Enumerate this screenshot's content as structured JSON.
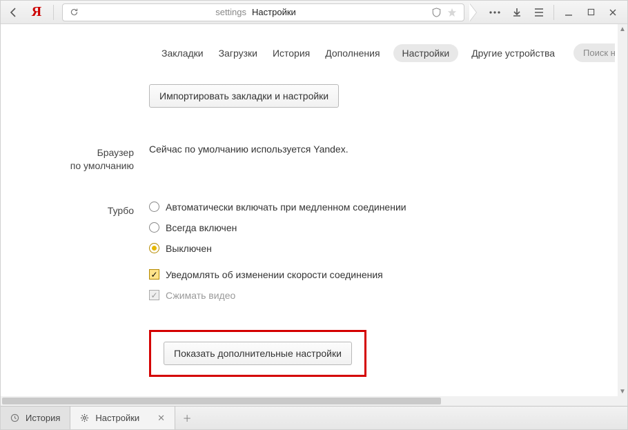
{
  "chrome": {
    "logo_text": "Я",
    "address_prefix": "settings",
    "address_title": "Настройки"
  },
  "tabs": {
    "bookmarks": "Закладки",
    "downloads": "Загрузки",
    "history": "История",
    "addons": "Дополнения",
    "settings": "Настройки",
    "devices": "Другие устройства",
    "search_placeholder": "Поиск н"
  },
  "import": {
    "button": "Импортировать закладки и настройки"
  },
  "default_browser": {
    "label_line1": "Браузер",
    "label_line2": "по умолчанию",
    "text": "Сейчас по умолчанию используется Yandex."
  },
  "turbo": {
    "label": "Турбо",
    "opt_auto": "Автоматически включать при медленном соединении",
    "opt_on": "Всегда включен",
    "opt_off": "Выключен",
    "chk_notify": "Уведомлять об изменении скорости соединения",
    "chk_compress": "Сжимать видео"
  },
  "show_more_button": "Показать дополнительные настройки",
  "footer": {
    "history": "История",
    "settings": "Настройки"
  }
}
